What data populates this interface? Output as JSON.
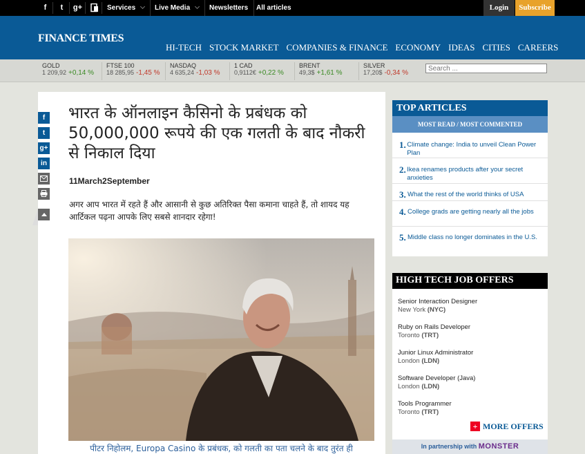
{
  "topbar": {
    "social": [
      "f",
      "t",
      "g+"
    ],
    "menus": [
      {
        "label": "Services",
        "dropdown": true
      },
      {
        "label": "Live Media",
        "dropdown": true
      },
      {
        "label": "Newsletters",
        "dropdown": false
      },
      {
        "label": "All articles",
        "dropdown": false
      }
    ],
    "login_label": "Login",
    "subscribe_label": "Subscribe"
  },
  "header": {
    "logo": "FINANCE TIMES",
    "nav": [
      "HI-TECH",
      "STOCK MARKET",
      "COMPANIES & FINANCE",
      "ECONOMY",
      "IDEAS",
      "CITIES",
      "CAREERS"
    ]
  },
  "ticker": [
    {
      "name": "GOLD",
      "value": "1 209,92",
      "change": "+0,14 %",
      "dir": "up"
    },
    {
      "name": "FTSE 100",
      "value": "18 285,95",
      "change": "-1,45 %",
      "dir": "down"
    },
    {
      "name": "NASDAQ",
      "value": "4 635,24",
      "change": "-1,03 %",
      "dir": "down"
    },
    {
      "name": "1 CAD",
      "value": "0,9112€",
      "change": "+0,22 %",
      "dir": "up"
    },
    {
      "name": "BRENT",
      "value": "49,3$",
      "change": "+1,61 %",
      "dir": "up"
    },
    {
      "name": "SILVER",
      "value": "17,20$",
      "change": "-0,34 %",
      "dir": "down"
    }
  ],
  "search": {
    "placeholder": "Search ..."
  },
  "article": {
    "headline": "भारत के ऑनलाइन कैसिनो के प्रबंधक को 50,000,000 रूपये की एक गलती के बाद नौकरी से निकाल दिया",
    "date": "11March2September",
    "lead": "अगर आप भारत में रहते हैं और आसानी से कुछ अतिरिक्त पैसा कमाना चाहते हैं, तो शायद यह आर्टिकल पढ़ना आपके लिए सबसे शानदार रहेगा!",
    "caption": "पीटर निहोलम, Europa Casino के प्रबंधक, को गलती का पता चलने के बाद तुरंत ही"
  },
  "share": [
    "f",
    "t",
    "g+",
    "in",
    "mail",
    "print"
  ],
  "top_articles": {
    "title": "TOP ARTICLES",
    "tabs": "MOST READ / MOST COMMENTED",
    "items": [
      {
        "num": "1.",
        "text": "Climate change: India to unveil Clean Power Plan"
      },
      {
        "num": "2.",
        "text": "Ikea renames products after your secret anxieties"
      },
      {
        "num": "3.",
        "text": "What the rest of the world thinks of USA"
      },
      {
        "num": "4.",
        "text": "College grads are getting nearly all the jobs"
      },
      {
        "num": "5.",
        "text": "Middle class no longer dominates in the U.S."
      }
    ]
  },
  "jobs": {
    "title": "HIGH TECH JOB OFFERS",
    "items": [
      {
        "title": "Senior Interaction Designer",
        "city": "New York",
        "code": "(NYC)"
      },
      {
        "title": "Ruby on Rails Developer",
        "city": "Toronto",
        "code": "(TRT)"
      },
      {
        "title": "Junior Linux Administrator",
        "city": "London",
        "code": "(LDN)"
      },
      {
        "title": "Software Developer (Java)",
        "city": "London",
        "code": "(LDN)"
      },
      {
        "title": "Tools Programmer",
        "city": "Toronto",
        "code": "(TRT)"
      }
    ],
    "more": "MORE OFFERS",
    "partner_prefix": "In partnership with",
    "partner_brand": "MONSTER"
  }
}
